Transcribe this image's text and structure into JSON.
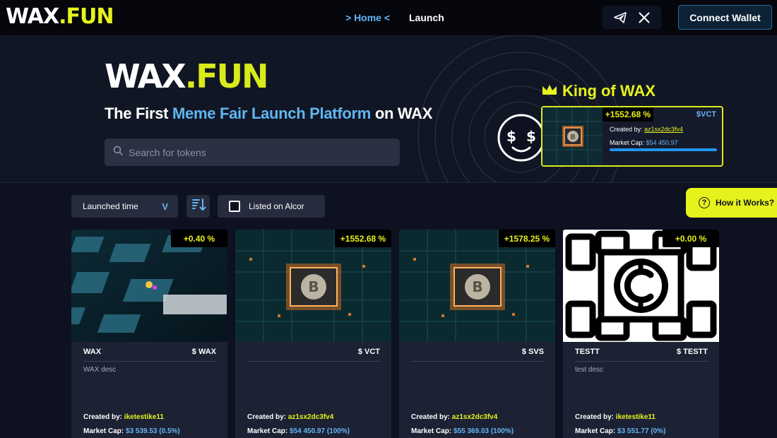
{
  "header": {
    "logo_wax": "WAX",
    "logo_dot": ".",
    "logo_fun": "FUN",
    "nav": {
      "home": "> Home <",
      "launch": "Launch"
    },
    "socials": [
      "telegram-icon",
      "x-icon"
    ],
    "connect_wallet": "Connect Wallet"
  },
  "hero": {
    "logo_wax": "WAX",
    "logo_dot": ".",
    "logo_fun": "FUN",
    "tagline_pre": "The First ",
    "tagline_accent": "Meme Fair Launch Platform",
    "tagline_post": " on WAX",
    "search_placeholder": "Search for tokens"
  },
  "king": {
    "title": "King of WAX",
    "percent": "+1552.68 %",
    "ticker": "$VCT",
    "created_label": "Created by: ",
    "creator": "az1sx2dc3fv4",
    "mcap_label": "Market Cap: ",
    "mcap_value": "$54 450.97",
    "progress": 1.0
  },
  "filters": {
    "sort_label": "Launched time",
    "sort_chevron": "V",
    "alcor_label": "Listed on Alcor",
    "how_label": "How it Works?",
    "how_icon": "?"
  },
  "cards": [
    {
      "name": "WAX",
      "ticker": "$ WAX",
      "percent": "+0.40 %",
      "description": "WAX desc",
      "created_label": "Created by: ",
      "creator": "iketestike11",
      "mcap_label": "Market Cap: ",
      "mcap_value": "$3 539.53 (0.5%)",
      "image": "screen-data-image"
    },
    {
      "name": "",
      "ticker": "$ VCT",
      "percent": "+1552.68 %",
      "description": "",
      "created_label": "Created by: ",
      "creator": "az1sx2dc3fv4",
      "mcap_label": "Market Cap: ",
      "mcap_value": "$54 450.97 (100%)",
      "image": "bitcoin-chip-image"
    },
    {
      "name": "",
      "ticker": "$ SVS",
      "percent": "+1578.25 %",
      "description": "",
      "created_label": "Created by: ",
      "creator": "az1sx2dc3fv4",
      "mcap_label": "Market Cap: ",
      "mcap_value": "$55 369.03 (100%)",
      "image": "bitcoin-chip-image"
    },
    {
      "name": "TESTT",
      "ticker": "$ TESTT",
      "percent": "+0.00 %",
      "description": "test desc",
      "created_label": "Created by: ",
      "creator": "iketestike11",
      "mcap_label": "Market Cap: ",
      "mcap_value": "$3 551.77 (0%)",
      "image": "chain-coin-image"
    }
  ],
  "colors": {
    "accent_yellow": "#e6f21c",
    "accent_blue": "#64b5f6",
    "background": "#0d1120"
  }
}
